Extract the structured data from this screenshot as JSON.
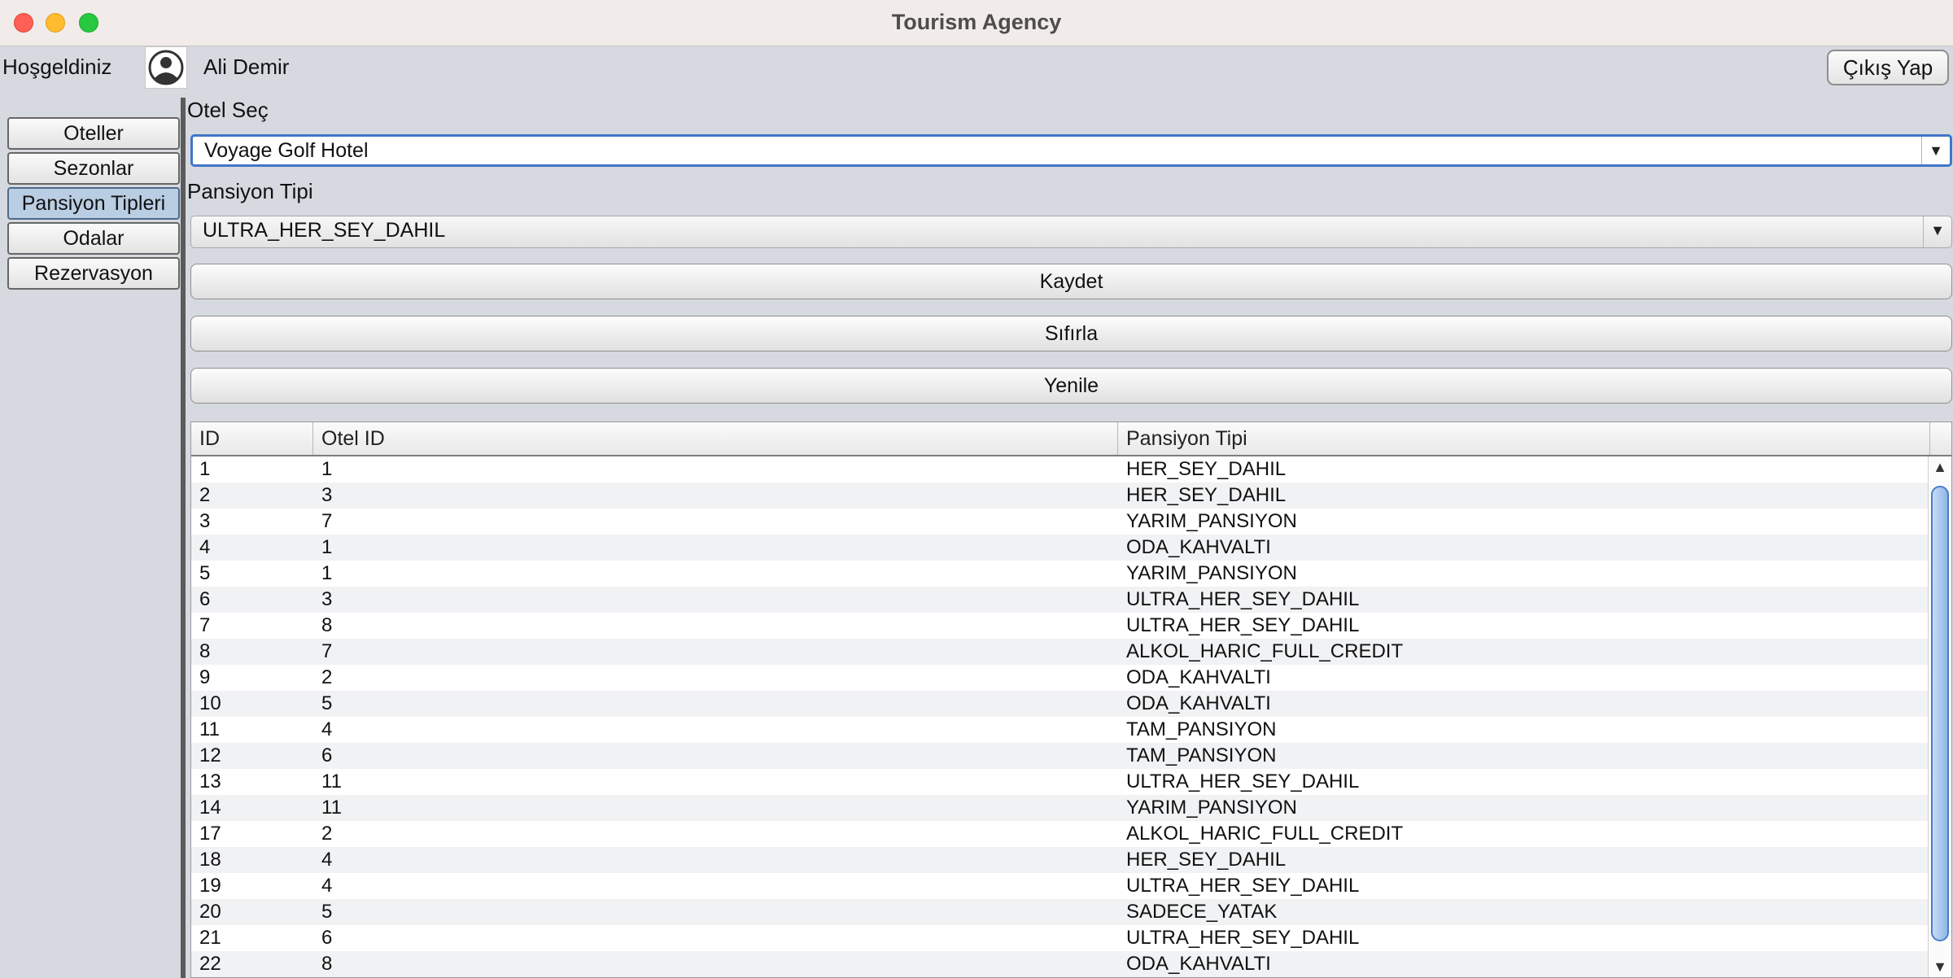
{
  "window": {
    "title": "Tourism Agency"
  },
  "header": {
    "welcome": "Hoşgeldiniz",
    "user_name": "Ali Demir",
    "logout_label": "Çıkış Yap"
  },
  "sidebar": {
    "items": [
      {
        "label": "Oteller"
      },
      {
        "label": "Sezonlar"
      },
      {
        "label": "Pansiyon Tipleri",
        "active": true
      },
      {
        "label": "Odalar"
      },
      {
        "label": "Rezervasyon"
      }
    ]
  },
  "form": {
    "hotel_label": "Otel Seç",
    "hotel_value": "Voyage Golf Hotel",
    "pension_label": "Pansiyon Tipi",
    "pension_value": "ULTRA_HER_SEY_DAHIL",
    "save_label": "Kaydet",
    "reset_label": "Sıfırla",
    "refresh_label": "Yenile"
  },
  "table": {
    "columns": [
      "ID",
      "Otel ID",
      "Pansiyon Tipi"
    ],
    "rows": [
      [
        "1",
        "1",
        "HER_SEY_DAHIL"
      ],
      [
        "2",
        "3",
        "HER_SEY_DAHIL"
      ],
      [
        "3",
        "7",
        "YARIM_PANSIYON"
      ],
      [
        "4",
        "1",
        "ODA_KAHVALTI"
      ],
      [
        "5",
        "1",
        "YARIM_PANSIYON"
      ],
      [
        "6",
        "3",
        "ULTRA_HER_SEY_DAHIL"
      ],
      [
        "7",
        "8",
        "ULTRA_HER_SEY_DAHIL"
      ],
      [
        "8",
        "7",
        "ALKOL_HARIC_FULL_CREDIT"
      ],
      [
        "9",
        "2",
        "ODA_KAHVALTI"
      ],
      [
        "10",
        "5",
        "ODA_KAHVALTI"
      ],
      [
        "11",
        "4",
        "TAM_PANSIYON"
      ],
      [
        "12",
        "6",
        "TAM_PANSIYON"
      ],
      [
        "13",
        "11",
        "ULTRA_HER_SEY_DAHIL"
      ],
      [
        "14",
        "11",
        "YARIM_PANSIYON"
      ],
      [
        "17",
        "2",
        "ALKOL_HARIC_FULL_CREDIT"
      ],
      [
        "18",
        "4",
        "HER_SEY_DAHIL"
      ],
      [
        "19",
        "4",
        "ULTRA_HER_SEY_DAHIL"
      ],
      [
        "20",
        "5",
        "SADECE_YATAK"
      ],
      [
        "21",
        "6",
        "ULTRA_HER_SEY_DAHIL"
      ],
      [
        "22",
        "8",
        "ODA_KAHVALTI"
      ]
    ]
  },
  "icons": {
    "avatar": "user-circle-icon",
    "combo_arrow": "chevron-down-icon",
    "scroll_up": "arrow-up-icon",
    "scroll_down": "arrow-down-icon"
  },
  "colors": {
    "window_bg": "#d6d9df",
    "active_tab": "#b9cde3",
    "focus_ring": "#3f76c9",
    "row_alt": "#f1f2f4"
  }
}
